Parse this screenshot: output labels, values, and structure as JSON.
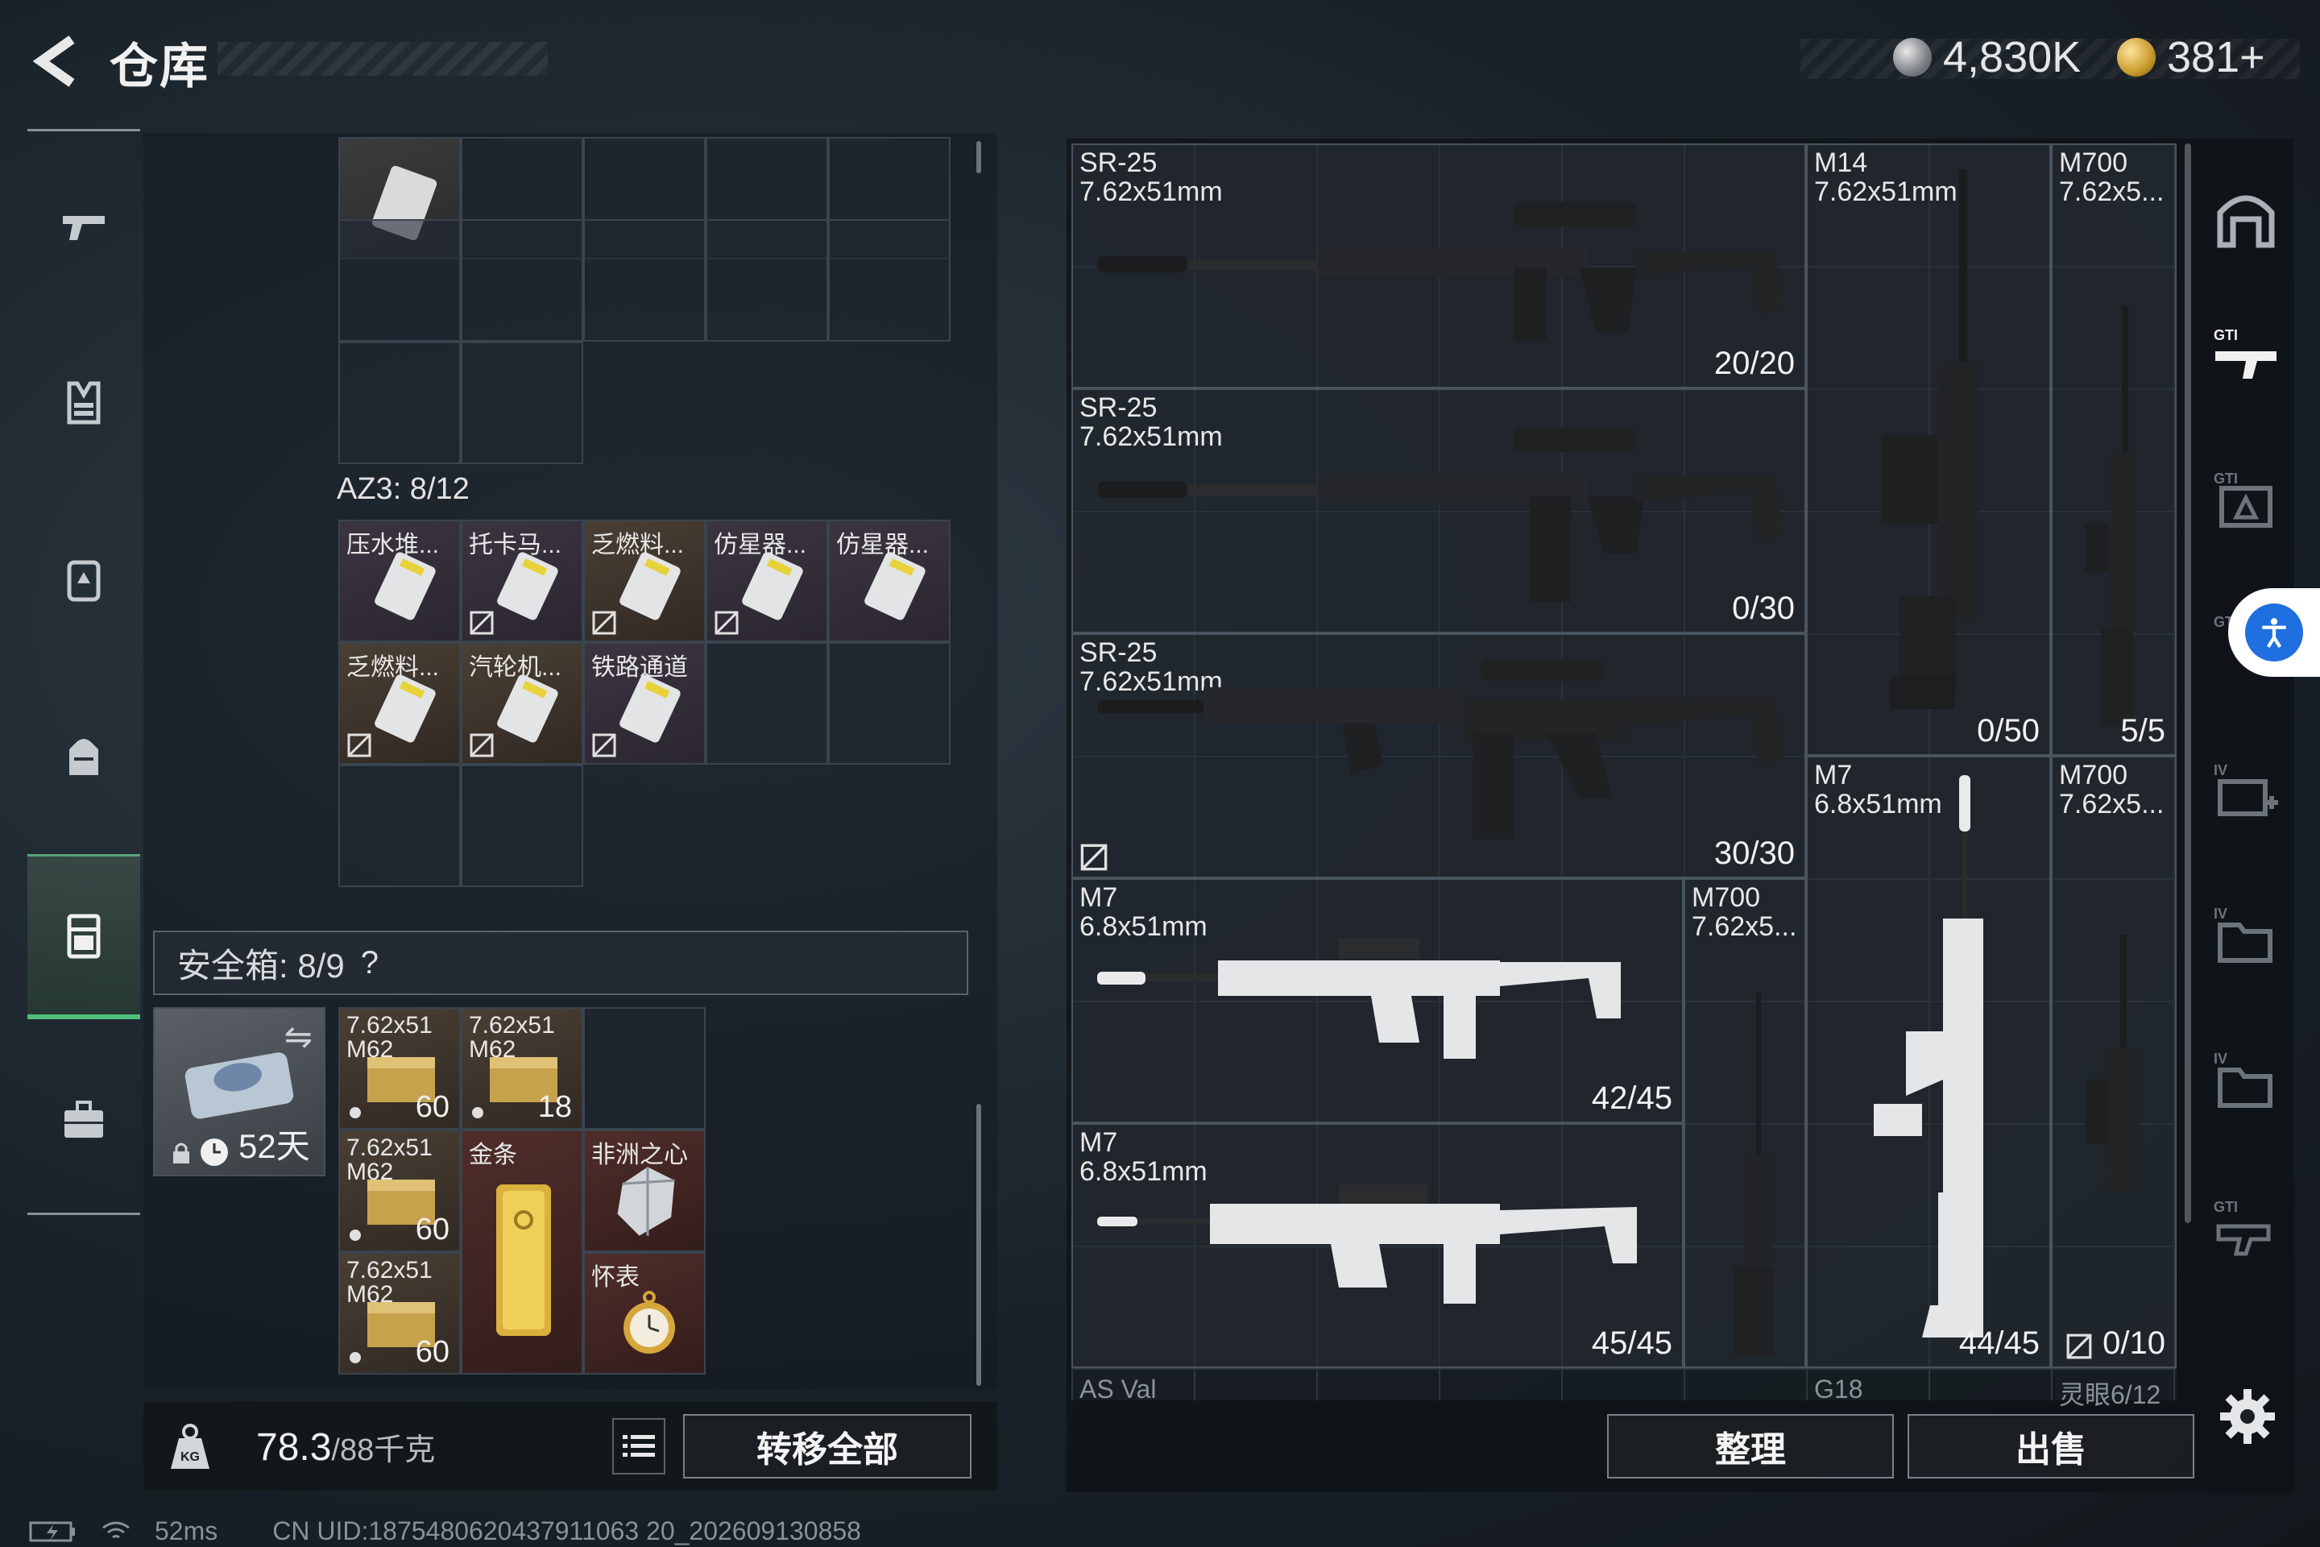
{
  "header": {
    "title": "仓库",
    "currency_silver": "4,830K",
    "currency_gold": "381+"
  },
  "left_nav": {
    "items": [
      "weapons",
      "armor",
      "chest-rig",
      "backpack",
      "storage",
      "case"
    ],
    "active": "storage"
  },
  "az3": {
    "label": "AZ3: 8/12",
    "items": [
      {
        "label": "压水堆...",
        "no_link": false
      },
      {
        "label": "托卡马...",
        "no_link": true
      },
      {
        "label": "乏燃料...",
        "no_link": true
      },
      {
        "label": "仿星器...",
        "no_link": true
      },
      {
        "label": "仿星器...",
        "no_link": false
      },
      {
        "label": "乏燃料...",
        "no_link": true
      },
      {
        "label": "汽轮机...",
        "no_link": true
      },
      {
        "label": "铁路通道",
        "no_link": true
      }
    ]
  },
  "safe": {
    "label": "安全箱: 8/9",
    "help": "?",
    "days": "52天",
    "items": [
      {
        "label": "7.62x51",
        "sub": "M62",
        "count": "60"
      },
      {
        "label": "7.62x51",
        "sub": "M62",
        "count": "18"
      },
      {
        "label": "7.62x51",
        "sub": "M62",
        "count": "60"
      },
      {
        "label": "金条",
        "sub": "",
        "count": ""
      },
      {
        "label": "非洲之心",
        "sub": "",
        "count": ""
      },
      {
        "label": "7.62x51",
        "sub": "M62",
        "count": "60"
      },
      {
        "label": "怀表",
        "sub": "",
        "count": ""
      }
    ]
  },
  "left_bottom": {
    "weight": "78.3",
    "weight_max": "/88千克",
    "transfer_all": "转移全部"
  },
  "status": {
    "ping": "52ms",
    "uid": "CN UID:1875480620437911063 20_202609130858"
  },
  "stash": {
    "weapons": [
      {
        "name": "SR-25",
        "caliber": "7.62x51mm",
        "count": "20/20"
      },
      {
        "name": "SR-25",
        "caliber": "7.62x51mm",
        "count": "0/30"
      },
      {
        "name": "SR-25",
        "caliber": "7.62x51mm",
        "count": "30/30"
      },
      {
        "name": "M14",
        "caliber": "7.62x51mm",
        "count": "0/50"
      },
      {
        "name": "M700",
        "caliber": "7.62x5...",
        "count": "5/5"
      },
      {
        "name": "M7",
        "caliber": "6.8x51mm",
        "count": "42/45"
      },
      {
        "name": "M7",
        "caliber": "6.8x51mm",
        "count": "45/45"
      },
      {
        "name": "M700",
        "caliber": "7.62x5...",
        "count": ""
      },
      {
        "name": "M7",
        "caliber": "6.8x51mm",
        "count": "44/45"
      },
      {
        "name": "M700",
        "caliber": "7.62x5...",
        "count": "0/10"
      }
    ],
    "bottom_labels": [
      "AS Val",
      "G18",
      "灵眼6/12"
    ],
    "sort": "整理",
    "sell": "出售"
  }
}
